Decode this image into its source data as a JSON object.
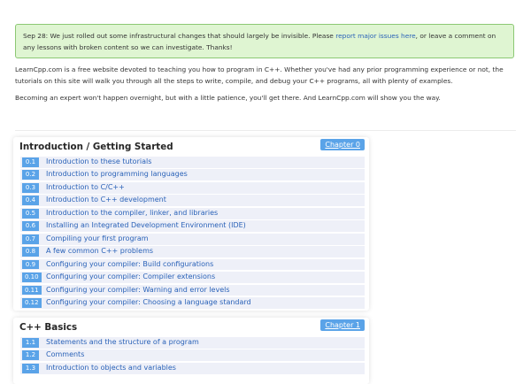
{
  "notice": {
    "text_before": "Sep 28: We just rolled out some infrastructural changes that should largely be invisible. Please ",
    "link": "report major issues here",
    "text_after": ", or leave a comment on any lessons with broken content so we can investigate. Thanks!"
  },
  "intro": {
    "p1": "LearnCpp.com is a free website devoted to teaching you how to program in C++. Whether you've had any prior programming experience or not, the tutorials on this site will walk you through all the steps to write, compile, and debug your C++ programs, all with plenty of examples.",
    "p2": "Becoming an expert won't happen overnight, but with a little patience, you'll get there. And LearnCpp.com will show you the way."
  },
  "chapters": [
    {
      "title": "Introduction / Getting Started",
      "badge": "Chapter 0",
      "lessons": [
        {
          "num": "0.1",
          "title": "Introduction to these tutorials"
        },
        {
          "num": "0.2",
          "title": "Introduction to programming languages"
        },
        {
          "num": "0.3",
          "title": "Introduction to C/C++"
        },
        {
          "num": "0.4",
          "title": "Introduction to C++ development"
        },
        {
          "num": "0.5",
          "title": "Introduction to the compiler, linker, and libraries"
        },
        {
          "num": "0.6",
          "title": "Installing an Integrated Development Environment (IDE)"
        },
        {
          "num": "0.7",
          "title": "Compiling your first program"
        },
        {
          "num": "0.8",
          "title": "A few common C++ problems"
        },
        {
          "num": "0.9",
          "title": "Configuring your compiler: Build configurations"
        },
        {
          "num": "0.10",
          "title": "Configuring your compiler: Compiler extensions"
        },
        {
          "num": "0.11",
          "title": "Configuring your compiler: Warning and error levels"
        },
        {
          "num": "0.12",
          "title": "Configuring your compiler: Choosing a language standard"
        }
      ]
    },
    {
      "title": "C++ Basics",
      "badge": "Chapter 1",
      "lessons": [
        {
          "num": "1.1",
          "title": "Statements and the structure of a program"
        },
        {
          "num": "1.2",
          "title": "Comments"
        },
        {
          "num": "1.3",
          "title": "Introduction to objects and variables"
        }
      ]
    }
  ]
}
